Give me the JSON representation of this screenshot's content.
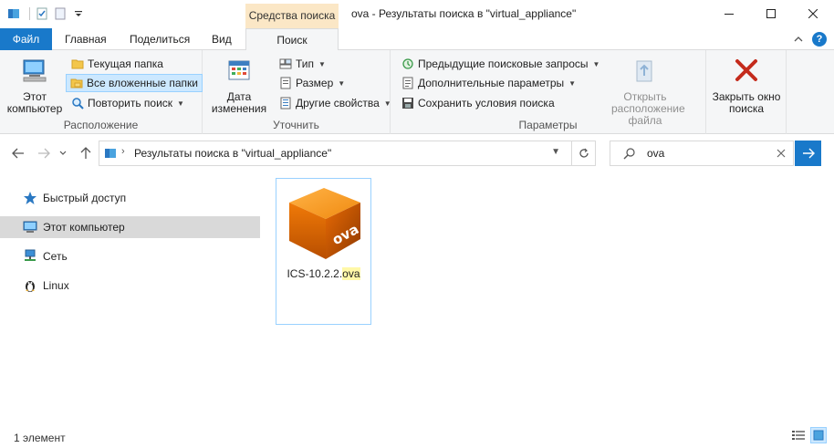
{
  "window": {
    "context_tab": "Средства поиска",
    "title": "ova - Результаты поиска в \"virtual_appliance\""
  },
  "tabs": {
    "file": "Файл",
    "home": "Главная",
    "share": "Поделиться",
    "view": "Вид",
    "search": "Поиск"
  },
  "ribbon": {
    "location": {
      "label": "Расположение",
      "this_pc": "Этот компьютер",
      "current_folder": "Текущая папка",
      "all_subfolders": "Все вложенные папки",
      "search_again": "Повторить поиск"
    },
    "refine": {
      "label": "Уточнить",
      "date_modified": "Дата изменения",
      "type": "Тип",
      "size": "Размер",
      "other_properties": "Другие свойства"
    },
    "options": {
      "label": "Параметры",
      "recent_searches": "Предыдущие поисковые запросы",
      "advanced_options": "Дополнительные параметры",
      "save_search": "Сохранить условия поиска",
      "open_location": "Открыть расположение файла"
    },
    "close": {
      "close_search": "Закрыть окно поиска"
    }
  },
  "address": {
    "path": "Результаты поиска в \"virtual_appliance\"",
    "search_query": "ova"
  },
  "sidebar": {
    "items": [
      {
        "label": "Быстрый доступ",
        "icon": "star-icon"
      },
      {
        "label": "Этот компьютер",
        "icon": "computer-icon"
      },
      {
        "label": "Сеть",
        "icon": "network-icon"
      },
      {
        "label": "Linux",
        "icon": "linux-icon"
      }
    ]
  },
  "files": [
    {
      "name_prefix": "ICS-10.2.2.",
      "name_match": "ova",
      "icon": "ova-package-icon"
    }
  ],
  "status": {
    "count": "1 элемент"
  },
  "colors": {
    "accent": "#1979ca",
    "context_tab": "#fbe7c6",
    "selection": "#cce8ff",
    "close_red": "#c42b1c"
  }
}
